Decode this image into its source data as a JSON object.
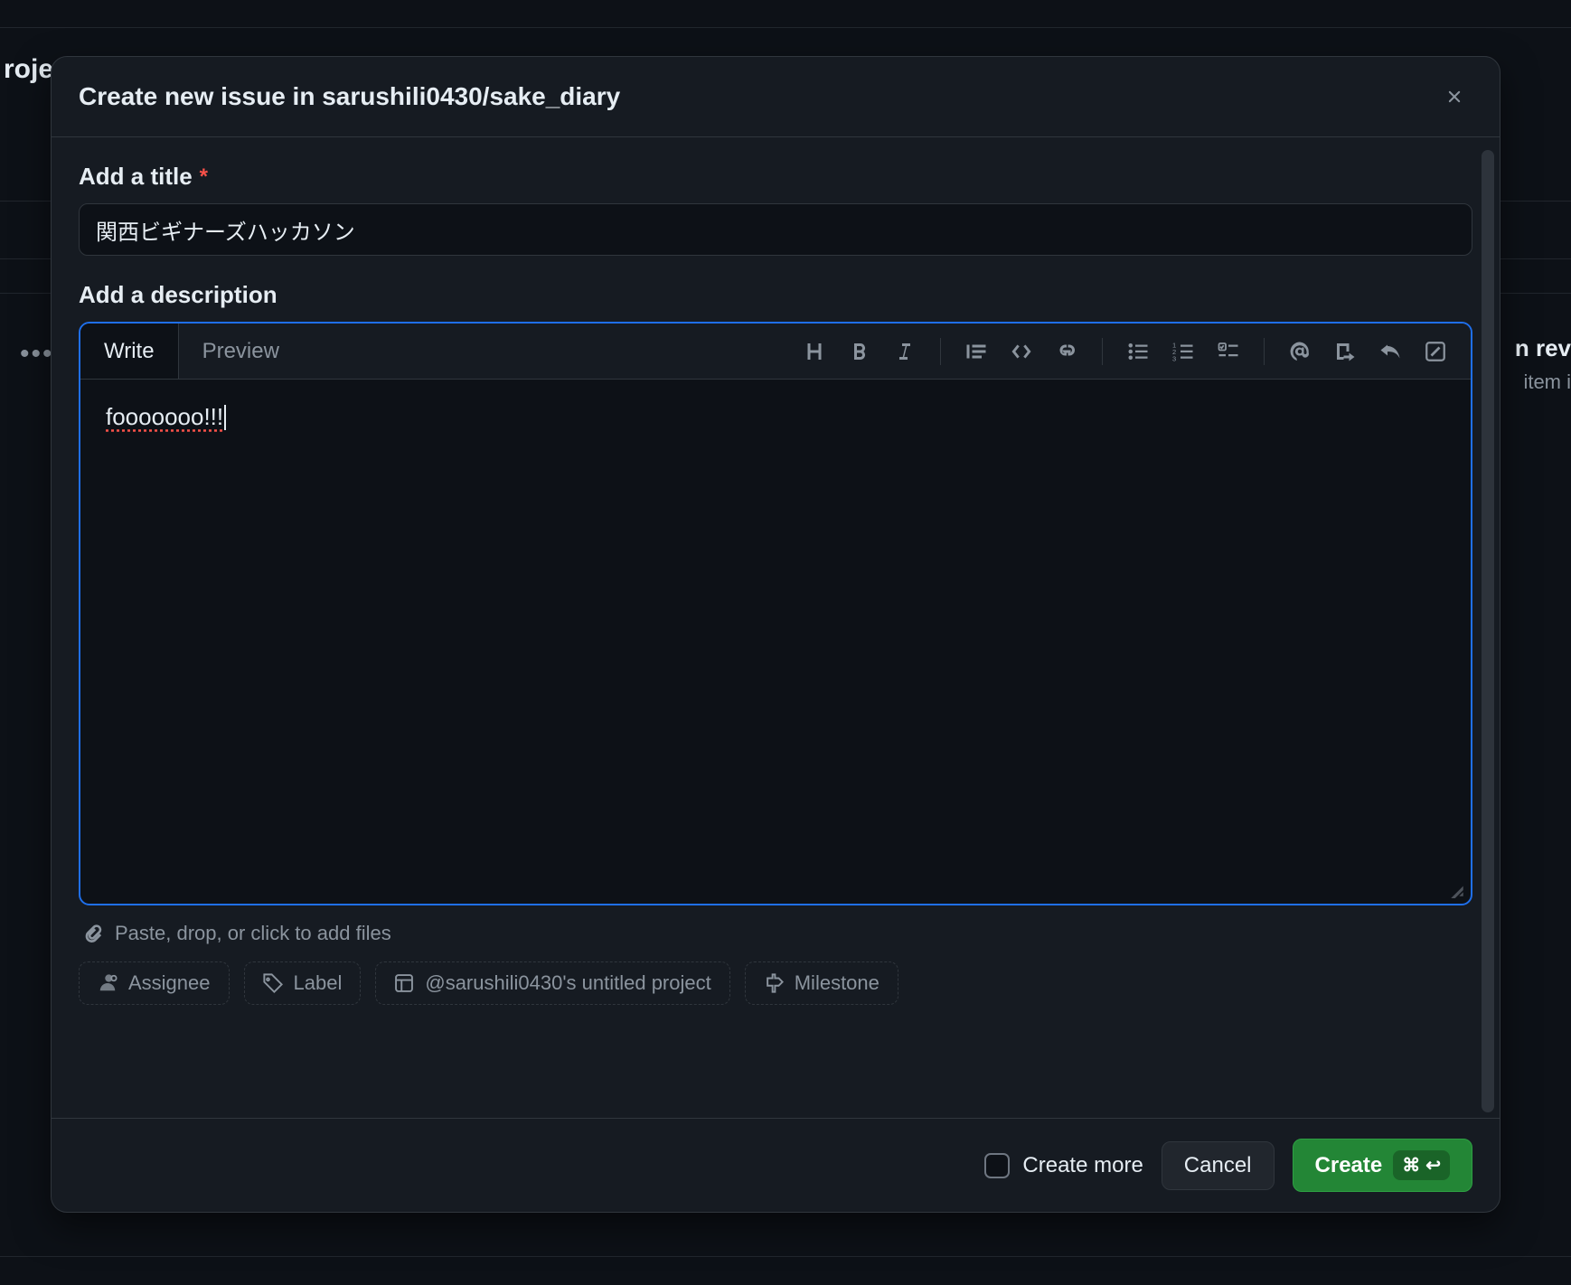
{
  "backdrop": {
    "proj_hint": "roje",
    "dots": "•••",
    "right_top": "n rev",
    "right_sub": "item i"
  },
  "modal": {
    "title": "Create new issue in sarushili0430/sake_diary",
    "title_label": "Add a title",
    "required_mark": "*",
    "title_value": "関西ビギナーズハッカソン",
    "desc_label": "Add a description",
    "tabs": {
      "write": "Write",
      "preview": "Preview"
    },
    "description_value": "fooooooo!!!",
    "attach_hint": "Paste, drop, or click to add files",
    "chips": {
      "assignee": "Assignee",
      "label": "Label",
      "project": "@sarushili0430's untitled project",
      "milestone": "Milestone"
    },
    "footer": {
      "create_more": "Create more",
      "cancel": "Cancel",
      "create": "Create",
      "shortcut_cmd": "⌘",
      "shortcut_enter": "↩"
    }
  }
}
